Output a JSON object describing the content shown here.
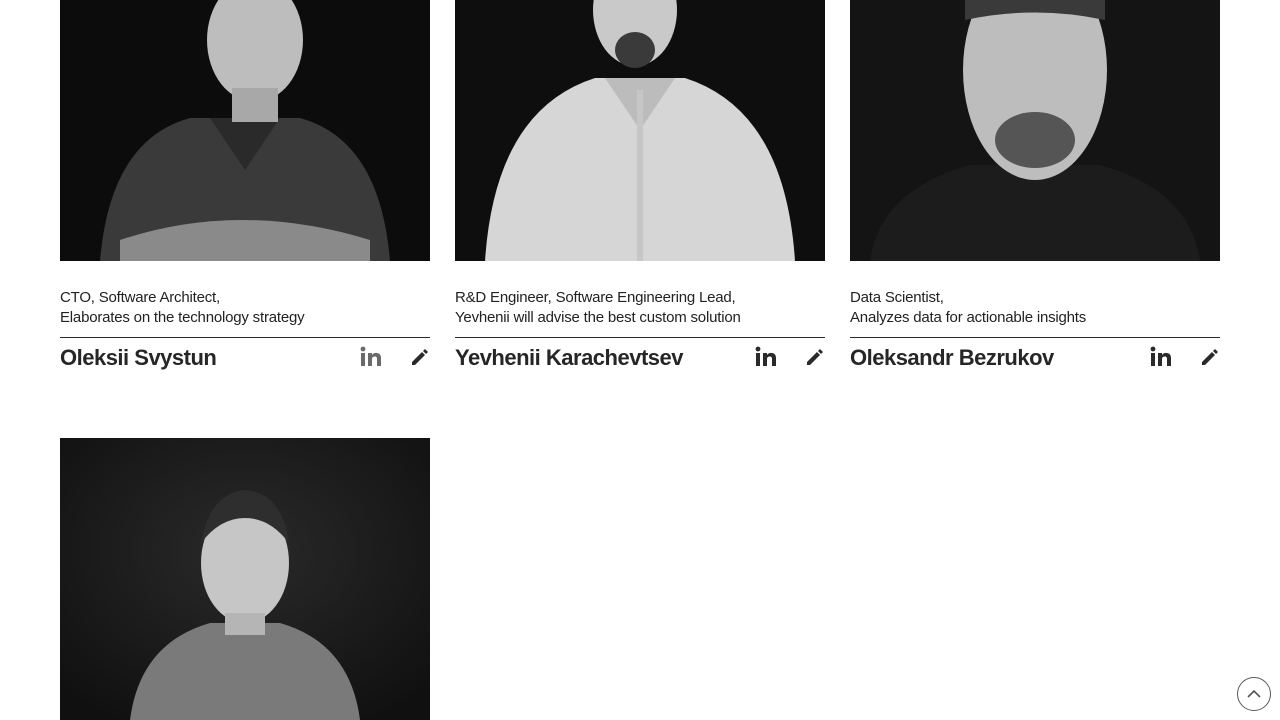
{
  "team": [
    {
      "role_line1": "CTO, Software Architect,",
      "role_line2": "Elaborates on the technology strategy",
      "name": "Oleksii Svystun",
      "linkedin_icon": "linkedin-icon",
      "edit_icon": "pencil-icon"
    },
    {
      "role_line1": "R&D Engineer, Software Engineering Lead,",
      "role_line2": "Yevhenii will advise the best custom solution",
      "name": "Yevhenii Karachevtsev",
      "linkedin_icon": "linkedin-icon",
      "edit_icon": "pencil-icon"
    },
    {
      "role_line1": "Data Scientist,",
      "role_line2": "Analyzes data for actionable insights",
      "name": "Oleksandr Bezrukov",
      "linkedin_icon": "linkedin-icon",
      "edit_icon": "pencil-icon"
    },
    {
      "photo_only": true
    }
  ],
  "scroll_top_icon": "chevron-up-icon",
  "colors": {
    "text": "#1f1f1f",
    "photo_bg": "#151515",
    "icon": "#2a2a2a",
    "icon_muted": "#6a6a6a"
  }
}
